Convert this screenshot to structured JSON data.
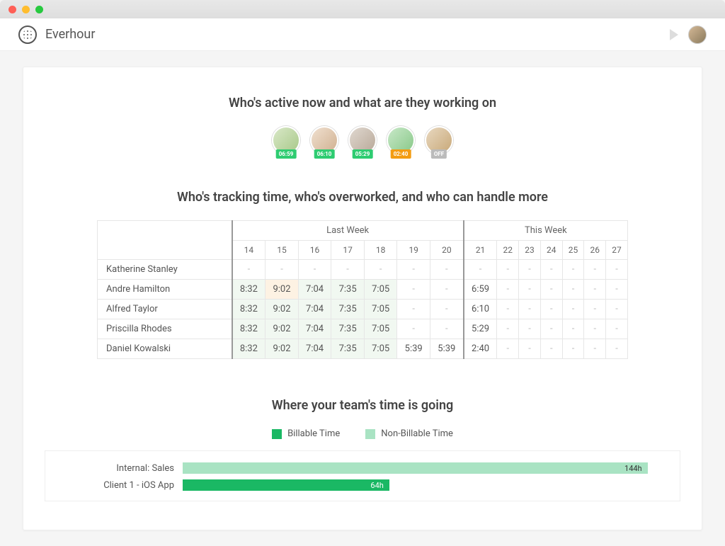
{
  "app": {
    "name": "Everhour"
  },
  "sections": {
    "active": {
      "title": "Who's active now and what are they working on",
      "people": [
        {
          "avatar_class": "av1",
          "badge": "06:59",
          "badge_color": "green"
        },
        {
          "avatar_class": "av2",
          "badge": "06:10",
          "badge_color": "green"
        },
        {
          "avatar_class": "av3",
          "badge": "05:29",
          "badge_color": "green"
        },
        {
          "avatar_class": "av4",
          "badge": "02:40",
          "badge_color": "orange"
        },
        {
          "avatar_class": "av5",
          "badge": "OFF",
          "badge_color": "gray"
        }
      ]
    },
    "tracking": {
      "title": "Who's tracking time, who's overworked, and who can handle more",
      "week_labels": [
        "Last Week",
        "This Week"
      ],
      "days": [
        "14",
        "15",
        "16",
        "17",
        "18",
        "19",
        "20",
        "21",
        "22",
        "23",
        "24",
        "25",
        "26",
        "27"
      ],
      "rows": [
        {
          "name": "Katherine Stanley",
          "cells": [
            "-",
            "-",
            "-",
            "-",
            "-",
            "-",
            "-",
            "-",
            "-",
            "-",
            "-",
            "-",
            "-",
            "-"
          ]
        },
        {
          "name": "Andre Hamilton",
          "cells": [
            "8:32",
            "9:02",
            "7:04",
            "7:35",
            "7:05",
            "-",
            "-",
            "6:59",
            "-",
            "-",
            "-",
            "-",
            "-",
            "-"
          ]
        },
        {
          "name": "Alfred Taylor",
          "cells": [
            "8:32",
            "9:02",
            "7:04",
            "7:35",
            "7:05",
            "-",
            "-",
            "6:10",
            "-",
            "-",
            "-",
            "-",
            "-",
            "-"
          ]
        },
        {
          "name": "Priscilla Rhodes",
          "cells": [
            "8:32",
            "9:02",
            "7:04",
            "7:35",
            "7:05",
            "-",
            "-",
            "5:29",
            "-",
            "-",
            "-",
            "-",
            "-",
            "-"
          ]
        },
        {
          "name": "Daniel Kowalski",
          "cells": [
            "8:32",
            "9:02",
            "7:04",
            "7:35",
            "7:05",
            "5:39",
            "5:39",
            "2:40",
            "-",
            "-",
            "-",
            "-",
            "-",
            "-"
          ]
        }
      ]
    },
    "timegoing": {
      "title": "Where your team's time is going",
      "legend": {
        "billable": "Billable Time",
        "nonbillable": "Non-Billable Time"
      }
    }
  },
  "chart_data": {
    "type": "bar",
    "orientation": "horizontal",
    "xlabel": "",
    "ylabel": "",
    "xlim": [
      0,
      150
    ],
    "series_names": [
      "Billable Time",
      "Non-Billable Time"
    ],
    "categories": [
      "Internal: Sales",
      "Client 1 - iOS App"
    ],
    "rows": [
      {
        "label": "Internal: Sales",
        "value": 144,
        "value_label": "144h",
        "kind": "nonbillable"
      },
      {
        "label": "Client 1 - iOS App",
        "value": 64,
        "value_label": "64h",
        "kind": "billable"
      }
    ]
  }
}
